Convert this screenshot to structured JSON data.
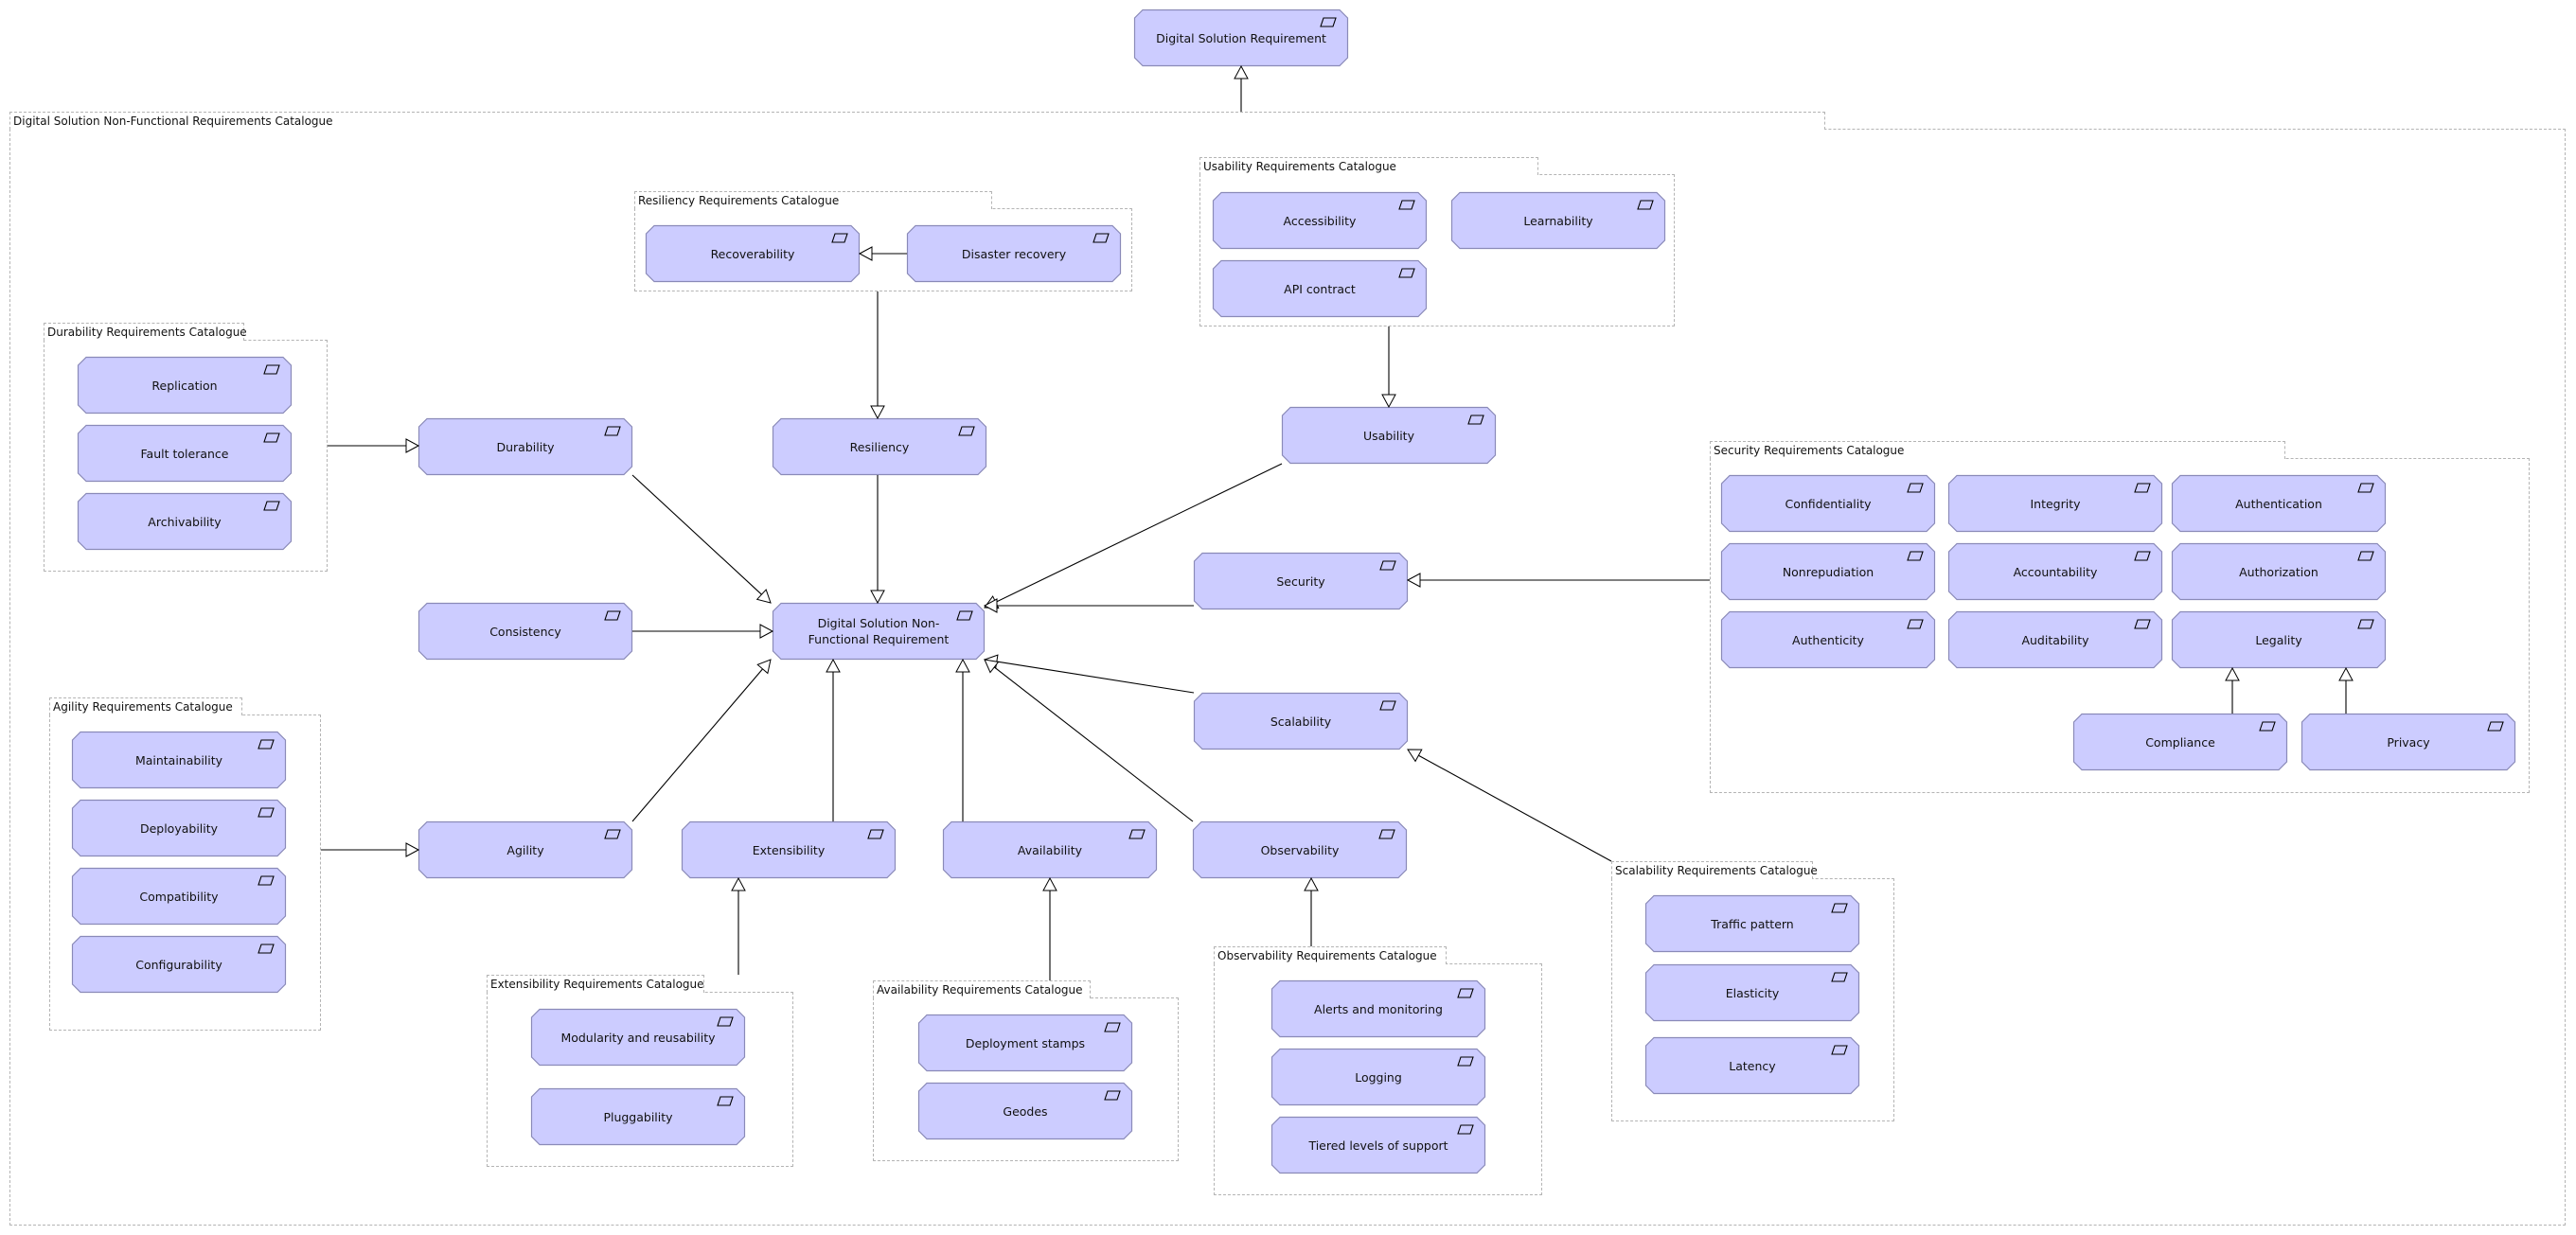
{
  "diagram": {
    "title": "Digital Solution Non-Functional Requirements Catalogue",
    "colors": {
      "node_fill": "#ccccff",
      "node_stroke": "#8a8ab8",
      "group_border": "#b4b4b4",
      "edge": "#000000"
    },
    "groups": {
      "root": "Digital Solution Non-Functional Requirements Catalogue",
      "resiliency": "Resiliency Requirements Catalogue",
      "usability": "Usability Requirements Catalogue",
      "durability": "Durability Requirements Catalogue",
      "security": "Security Requirements Catalogue",
      "agility": "Agility Requirements Catalogue",
      "extensibility": "Extensibility Requirements Catalogue",
      "availability": "Availability Requirements Catalogue",
      "observability": "Observability Requirements Catalogue",
      "scalability": "Scalability Requirements Catalogue"
    },
    "nodes": {
      "dsr": "Digital Solution Requirement",
      "nfr": "Digital Solution Non-Functional Requirement",
      "recoverability": "Recoverability",
      "disaster_recovery": "Disaster recovery",
      "accessibility": "Accessibility",
      "learnability": "Learnability",
      "api_contract": "API contract",
      "replication": "Replication",
      "fault_tolerance": "Fault tolerance",
      "archivability": "Archivability",
      "durability": "Durability",
      "resiliency": "Resiliency",
      "usability": "Usability",
      "consistency": "Consistency",
      "security": "Security",
      "scalability": "Scalability",
      "confidentiality": "Confidentiality",
      "integrity": "Integrity",
      "authentication": "Authentication",
      "nonrepudiation": "Nonrepudiation",
      "accountability": "Accountability",
      "authorization": "Authorization",
      "authenticity": "Authenticity",
      "auditability": "Auditability",
      "legality": "Legality",
      "compliance": "Compliance",
      "privacy": "Privacy",
      "maintainability": "Maintainability",
      "deployability": "Deployability",
      "compatibility": "Compatibility",
      "configurability": "Configurability",
      "agility": "Agility",
      "extensibility": "Extensibility",
      "availability": "Availability",
      "observability": "Observability",
      "modularity": "Modularity and reusability",
      "pluggability": "Pluggability",
      "deployment_stamps": "Deployment stamps",
      "geodes": "Geodes",
      "alerts": "Alerts and monitoring",
      "logging": "Logging",
      "tiered_support": "Tiered levels of support",
      "traffic_pattern": "Traffic pattern",
      "elasticity": "Elasticity",
      "latency": "Latency"
    },
    "relationships": [
      {
        "type": "specialization",
        "from": "group:root",
        "to": "dsr"
      },
      {
        "type": "specialization",
        "from": "disaster_recovery",
        "to": "recoverability"
      },
      {
        "type": "specialization",
        "from": "group:resiliency",
        "to": "resiliency"
      },
      {
        "type": "specialization",
        "from": "group:usability",
        "to": "usability"
      },
      {
        "type": "specialization",
        "from": "group:durability",
        "to": "durability"
      },
      {
        "type": "specialization",
        "from": "group:security",
        "to": "security"
      },
      {
        "type": "specialization",
        "from": "group:agility",
        "to": "agility"
      },
      {
        "type": "specialization",
        "from": "group:extensibility",
        "to": "extensibility"
      },
      {
        "type": "specialization",
        "from": "group:availability",
        "to": "availability"
      },
      {
        "type": "specialization",
        "from": "group:observability",
        "to": "observability"
      },
      {
        "type": "specialization",
        "from": "group:scalability",
        "to": "scalability"
      },
      {
        "type": "specialization",
        "from": "compliance",
        "to": "legality"
      },
      {
        "type": "specialization",
        "from": "privacy",
        "to": "legality"
      },
      {
        "type": "specialization",
        "from": "durability",
        "to": "nfr"
      },
      {
        "type": "specialization",
        "from": "resiliency",
        "to": "nfr"
      },
      {
        "type": "specialization",
        "from": "consistency",
        "to": "nfr"
      },
      {
        "type": "specialization",
        "from": "usability",
        "to": "nfr"
      },
      {
        "type": "specialization",
        "from": "security",
        "to": "nfr"
      },
      {
        "type": "specialization",
        "from": "scalability",
        "to": "nfr"
      },
      {
        "type": "specialization",
        "from": "agility",
        "to": "nfr"
      },
      {
        "type": "specialization",
        "from": "extensibility",
        "to": "nfr"
      },
      {
        "type": "specialization",
        "from": "availability",
        "to": "nfr"
      },
      {
        "type": "specialization",
        "from": "observability",
        "to": "nfr"
      }
    ]
  }
}
